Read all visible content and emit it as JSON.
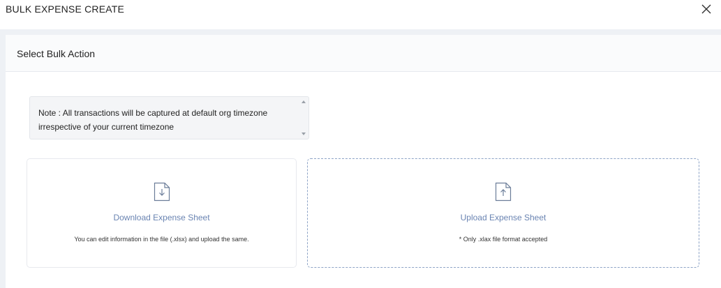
{
  "header": {
    "title": "BULK EXPENSE CREATE",
    "close_icon": "close-icon"
  },
  "panel": {
    "title": "Select Bulk Action",
    "note": {
      "line1": "Note : All transactions will be captured at default org timezone",
      "line2": "irrespective of your current timezone"
    },
    "download_card": {
      "icon": "file-download-icon",
      "title": "Download Expense Sheet",
      "subtitle": "You can edit information in the file (.xlsx) and upload the same."
    },
    "upload_card": {
      "icon": "file-upload-icon",
      "title": "Upload Expense Sheet",
      "subtitle": "* Only .xlax file format accepted"
    }
  },
  "colors": {
    "accent": "#6a84b2",
    "dashed_border": "#8da3c6",
    "background": "#eef1f5"
  }
}
